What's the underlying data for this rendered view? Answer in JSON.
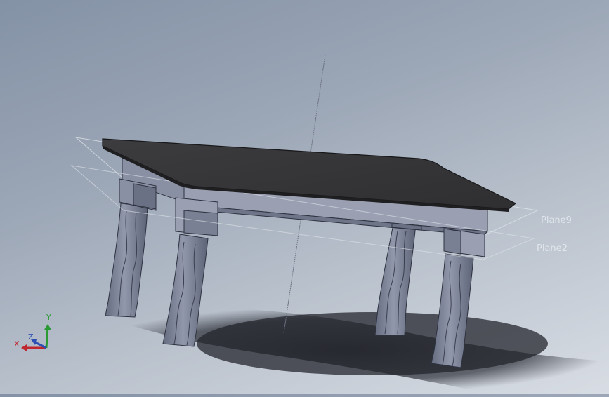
{
  "planes": [
    {
      "name": "Plane9"
    },
    {
      "name": "Plane2"
    }
  ],
  "triad": {
    "x": "X",
    "y": "Y",
    "z": "Z"
  },
  "colors": {
    "tabletop": "#3b3b3d",
    "frame": "#8a90a3",
    "legs": "#7f859a",
    "plane_outline": "#dfe4ea",
    "axis_x": "#c0262d",
    "axis_y": "#2a9a34",
    "axis_z": "#2d4fb3"
  }
}
